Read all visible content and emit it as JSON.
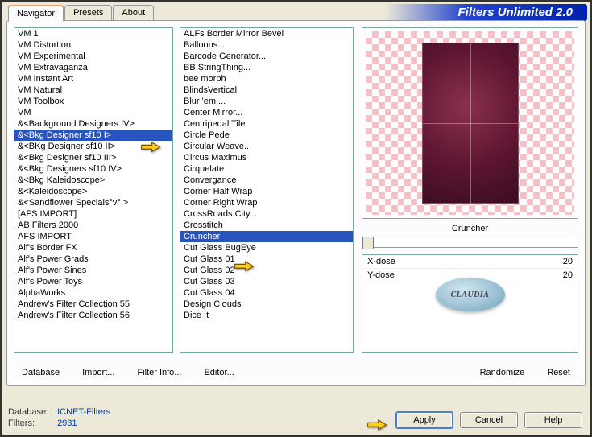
{
  "title": "Filters Unlimited 2.0",
  "tabs": [
    "Navigator",
    "Presets",
    "About"
  ],
  "activeTab": 0,
  "list1_items": [
    "VM 1",
    "VM Distortion",
    "VM Experimental",
    "VM Extravaganza",
    "VM Instant Art",
    "VM Natural",
    "VM Toolbox",
    "VM",
    "&<Background Designers IV>",
    "&<Bkg Designer sf10 I>",
    "&<BKg Designer sf10 II>",
    "&<Bkg Designer sf10 III>",
    "&<Bkg Designers sf10 IV>",
    "&<Bkg Kaleidoscope>",
    "&<Kaleidoscope>",
    "&<Sandflower Specials°v° >",
    "[AFS IMPORT]",
    "AB Filters 2000",
    "AFS IMPORT",
    "Alf's Border FX",
    "Alf's Power Grads",
    "Alf's Power Sines",
    "Alf's Power Toys",
    "AlphaWorks",
    "Andrew's Filter Collection 55",
    "Andrew's Filter Collection 56"
  ],
  "list1_selected": 9,
  "list2_items": [
    "ALFs Border Mirror Bevel",
    "Balloons...",
    "Barcode Generator...",
    "BB StringThing...",
    "bee morph",
    "BlindsVertical",
    "Blur 'em!...",
    "Center Mirror...",
    "Centripedal Tile",
    "Circle Pede",
    "Circular Weave...",
    "Circus Maximus",
    "Cirquelate",
    "Convergance",
    "Corner Half Wrap",
    "Corner Right Wrap",
    "CrossRoads City...",
    "Crosstitch",
    "Cruncher",
    "Cut Glass  BugEye",
    "Cut Glass 01",
    "Cut Glass 02",
    "Cut Glass 03",
    "Cut Glass 04",
    "Design Clouds",
    "Dice It"
  ],
  "list2_selected": 18,
  "filterName": "Cruncher",
  "params": [
    {
      "name": "X-dose",
      "value": "20"
    },
    {
      "name": "Y-dose",
      "value": "20"
    }
  ],
  "links_left": [
    "Database",
    "Import...",
    "Filter Info...",
    "Editor..."
  ],
  "links_right": [
    "Randomize",
    "Reset"
  ],
  "footer": {
    "db_label": "Database:",
    "db_val": "ICNET-Filters",
    "flt_label": "Filters:",
    "flt_val": "2931"
  },
  "buttons": [
    "Apply",
    "Cancel",
    "Help"
  ],
  "watermark": "CLAUDIA"
}
